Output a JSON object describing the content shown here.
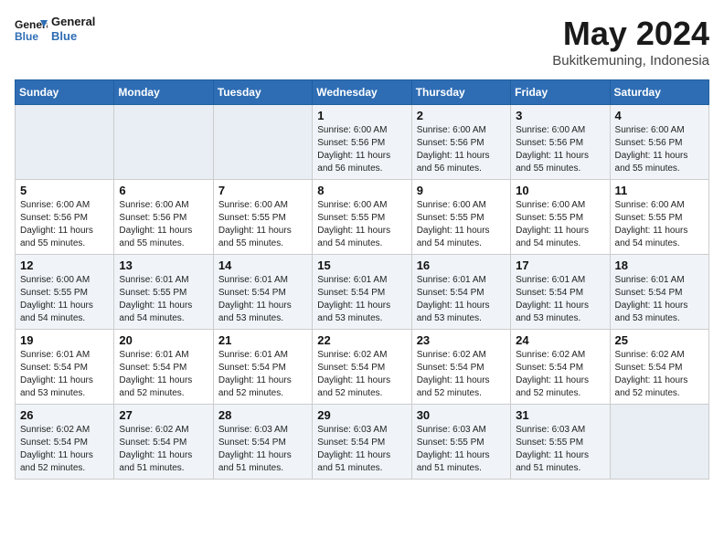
{
  "header": {
    "logo_line1": "General",
    "logo_line2": "Blue",
    "month": "May 2024",
    "location": "Bukitkemuning, Indonesia"
  },
  "weekdays": [
    "Sunday",
    "Monday",
    "Tuesday",
    "Wednesday",
    "Thursday",
    "Friday",
    "Saturday"
  ],
  "weeks": [
    [
      {
        "day": "",
        "text": ""
      },
      {
        "day": "",
        "text": ""
      },
      {
        "day": "",
        "text": ""
      },
      {
        "day": "1",
        "text": "Sunrise: 6:00 AM\nSunset: 5:56 PM\nDaylight: 11 hours and 56 minutes."
      },
      {
        "day": "2",
        "text": "Sunrise: 6:00 AM\nSunset: 5:56 PM\nDaylight: 11 hours and 56 minutes."
      },
      {
        "day": "3",
        "text": "Sunrise: 6:00 AM\nSunset: 5:56 PM\nDaylight: 11 hours and 55 minutes."
      },
      {
        "day": "4",
        "text": "Sunrise: 6:00 AM\nSunset: 5:56 PM\nDaylight: 11 hours and 55 minutes."
      }
    ],
    [
      {
        "day": "5",
        "text": "Sunrise: 6:00 AM\nSunset: 5:56 PM\nDaylight: 11 hours and 55 minutes."
      },
      {
        "day": "6",
        "text": "Sunrise: 6:00 AM\nSunset: 5:56 PM\nDaylight: 11 hours and 55 minutes."
      },
      {
        "day": "7",
        "text": "Sunrise: 6:00 AM\nSunset: 5:55 PM\nDaylight: 11 hours and 55 minutes."
      },
      {
        "day": "8",
        "text": "Sunrise: 6:00 AM\nSunset: 5:55 PM\nDaylight: 11 hours and 54 minutes."
      },
      {
        "day": "9",
        "text": "Sunrise: 6:00 AM\nSunset: 5:55 PM\nDaylight: 11 hours and 54 minutes."
      },
      {
        "day": "10",
        "text": "Sunrise: 6:00 AM\nSunset: 5:55 PM\nDaylight: 11 hours and 54 minutes."
      },
      {
        "day": "11",
        "text": "Sunrise: 6:00 AM\nSunset: 5:55 PM\nDaylight: 11 hours and 54 minutes."
      }
    ],
    [
      {
        "day": "12",
        "text": "Sunrise: 6:00 AM\nSunset: 5:55 PM\nDaylight: 11 hours and 54 minutes."
      },
      {
        "day": "13",
        "text": "Sunrise: 6:01 AM\nSunset: 5:55 PM\nDaylight: 11 hours and 54 minutes."
      },
      {
        "day": "14",
        "text": "Sunrise: 6:01 AM\nSunset: 5:54 PM\nDaylight: 11 hours and 53 minutes."
      },
      {
        "day": "15",
        "text": "Sunrise: 6:01 AM\nSunset: 5:54 PM\nDaylight: 11 hours and 53 minutes."
      },
      {
        "day": "16",
        "text": "Sunrise: 6:01 AM\nSunset: 5:54 PM\nDaylight: 11 hours and 53 minutes."
      },
      {
        "day": "17",
        "text": "Sunrise: 6:01 AM\nSunset: 5:54 PM\nDaylight: 11 hours and 53 minutes."
      },
      {
        "day": "18",
        "text": "Sunrise: 6:01 AM\nSunset: 5:54 PM\nDaylight: 11 hours and 53 minutes."
      }
    ],
    [
      {
        "day": "19",
        "text": "Sunrise: 6:01 AM\nSunset: 5:54 PM\nDaylight: 11 hours and 53 minutes."
      },
      {
        "day": "20",
        "text": "Sunrise: 6:01 AM\nSunset: 5:54 PM\nDaylight: 11 hours and 52 minutes."
      },
      {
        "day": "21",
        "text": "Sunrise: 6:01 AM\nSunset: 5:54 PM\nDaylight: 11 hours and 52 minutes."
      },
      {
        "day": "22",
        "text": "Sunrise: 6:02 AM\nSunset: 5:54 PM\nDaylight: 11 hours and 52 minutes."
      },
      {
        "day": "23",
        "text": "Sunrise: 6:02 AM\nSunset: 5:54 PM\nDaylight: 11 hours and 52 minutes."
      },
      {
        "day": "24",
        "text": "Sunrise: 6:02 AM\nSunset: 5:54 PM\nDaylight: 11 hours and 52 minutes."
      },
      {
        "day": "25",
        "text": "Sunrise: 6:02 AM\nSunset: 5:54 PM\nDaylight: 11 hours and 52 minutes."
      }
    ],
    [
      {
        "day": "26",
        "text": "Sunrise: 6:02 AM\nSunset: 5:54 PM\nDaylight: 11 hours and 52 minutes."
      },
      {
        "day": "27",
        "text": "Sunrise: 6:02 AM\nSunset: 5:54 PM\nDaylight: 11 hours and 51 minutes."
      },
      {
        "day": "28",
        "text": "Sunrise: 6:03 AM\nSunset: 5:54 PM\nDaylight: 11 hours and 51 minutes."
      },
      {
        "day": "29",
        "text": "Sunrise: 6:03 AM\nSunset: 5:54 PM\nDaylight: 11 hours and 51 minutes."
      },
      {
        "day": "30",
        "text": "Sunrise: 6:03 AM\nSunset: 5:55 PM\nDaylight: 11 hours and 51 minutes."
      },
      {
        "day": "31",
        "text": "Sunrise: 6:03 AM\nSunset: 5:55 PM\nDaylight: 11 hours and 51 minutes."
      },
      {
        "day": "",
        "text": ""
      }
    ]
  ]
}
